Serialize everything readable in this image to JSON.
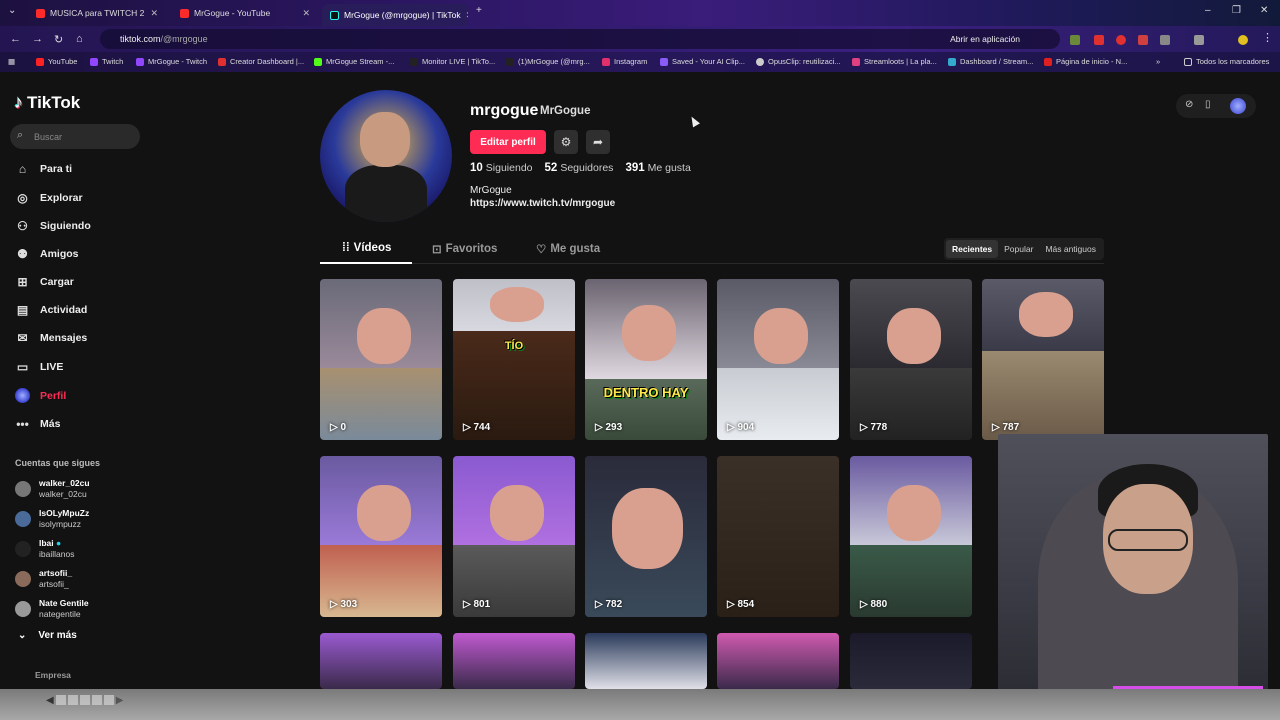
{
  "browser": {
    "tabs": [
      {
        "title": "MUSICA para TWITCH 2",
        "active": false
      },
      {
        "title": "MrGogue - YouTube",
        "active": false
      },
      {
        "title": "MrGogue (@mrgogue) | TikTok",
        "active": true
      }
    ],
    "url_host": "tiktok.com",
    "url_path": "/@mrgogue",
    "open_in_app": "Abrir en aplicación",
    "bookmarks": [
      "YouTube",
      "Twitch",
      "MrGogue - Twitch",
      "Creator Dashboard |...",
      "MrGogue Stream -...",
      "Monitor LIVE | TikTo...",
      "(1)MrGogue (@mrg...",
      "Instagram",
      "Saved - Your AI Clip...",
      "OpusClip: reutilizaci...",
      "Streamloots | La pla...",
      "Dashboard / Stream...",
      "Página de inicio - N..."
    ],
    "all_bookmarks": "Todos los marcadores"
  },
  "sidebar": {
    "logo": "TikTok",
    "search_placeholder": "Buscar",
    "nav": [
      {
        "label": "Para ti",
        "icon": "home-icon"
      },
      {
        "label": "Explorar",
        "icon": "compass-icon"
      },
      {
        "label": "Siguiendo",
        "icon": "following-icon"
      },
      {
        "label": "Amigos",
        "icon": "friends-icon"
      },
      {
        "label": "Cargar",
        "icon": "upload-icon"
      },
      {
        "label": "Actividad",
        "icon": "activity-icon"
      },
      {
        "label": "Mensajes",
        "icon": "messages-icon"
      },
      {
        "label": "LIVE",
        "icon": "live-icon"
      },
      {
        "label": "Perfil",
        "icon": "profile-avatar-icon"
      },
      {
        "label": "Más",
        "icon": "more-icon"
      }
    ],
    "following_title": "Cuentas que sigues",
    "following": [
      {
        "name": "walker_02cu",
        "handle": "walker_02cu"
      },
      {
        "name": "IsOLyMpuZz",
        "handle": "isolympuzz"
      },
      {
        "name": "Ibai",
        "handle": "ibaillanos"
      },
      {
        "name": "artsofii_",
        "handle": "artsofii_"
      },
      {
        "name": "Nate Gentile",
        "handle": "nategentile"
      }
    ],
    "see_more": "Ver más",
    "company": "Empresa"
  },
  "profile": {
    "username": "mrgogue",
    "nickname": "MrGogue",
    "edit_label": "Editar perfil",
    "following_count": "10",
    "following_label": "Siguiendo",
    "followers_count": "52",
    "followers_label": "Seguidores",
    "likes_count": "391",
    "likes_label": "Me gusta",
    "bio_name": "MrGogue",
    "bio_link": "https://www.twitch.tv/mrgogue"
  },
  "tabs": {
    "videos": "Vídeos",
    "favorites": "Favoritos",
    "liked": "Me gusta",
    "sort": [
      "Recientes",
      "Popular",
      "Más antiguos"
    ]
  },
  "videos": [
    {
      "views": "0"
    },
    {
      "views": "744",
      "caption": "TÍO"
    },
    {
      "views": "293",
      "caption": "DENTRO HAY"
    },
    {
      "views": "904"
    },
    {
      "views": "778"
    },
    {
      "views": "787"
    },
    {
      "views": "303"
    },
    {
      "views": "801"
    },
    {
      "views": "782"
    },
    {
      "views": "854"
    },
    {
      "views": "880"
    }
  ],
  "colors": {
    "accent": "#fe2c55"
  }
}
